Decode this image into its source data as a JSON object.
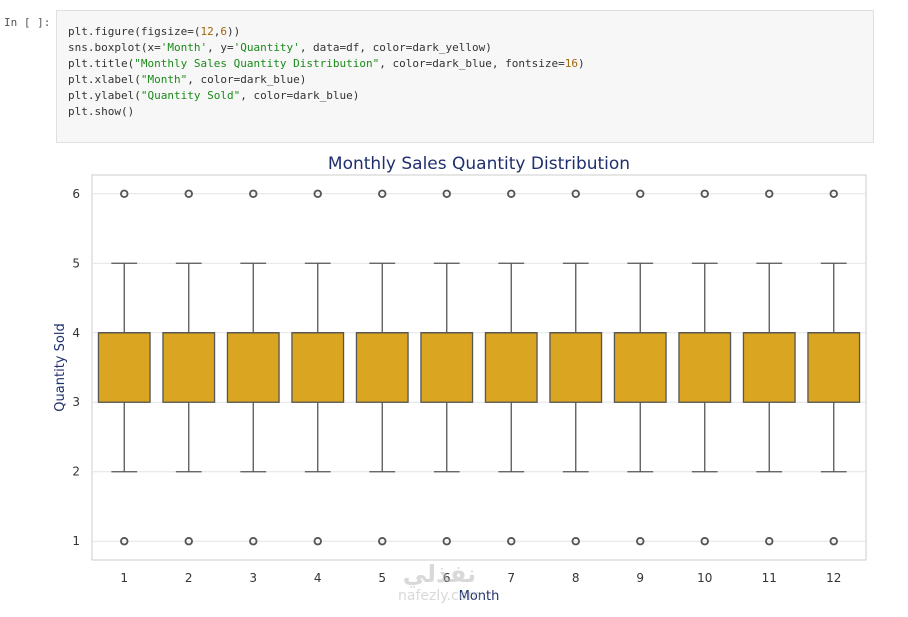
{
  "cell": {
    "prompt": "In [ ]:",
    "code_lines": [
      [
        [
          "plt.figure(figsize=(",
          ""
        ],
        [
          "12",
          "num"
        ],
        [
          ",",
          ""
        ],
        [
          "6",
          "num"
        ],
        [
          "))",
          ""
        ]
      ],
      [
        [
          "sns.boxplot(x=",
          ""
        ],
        [
          "'Month'",
          "str"
        ],
        [
          ", y=",
          ""
        ],
        [
          "'Quantity'",
          "str"
        ],
        [
          ", data=df, color=dark_yellow)",
          ""
        ]
      ],
      [
        [
          "plt.title(",
          ""
        ],
        [
          "\"Monthly Sales Quantity Distribution\"",
          "str"
        ],
        [
          ", color=dark_blue, fontsize=",
          ""
        ],
        [
          "16",
          "num"
        ],
        [
          ")",
          ""
        ]
      ],
      [
        [
          "plt.xlabel(",
          ""
        ],
        [
          "\"Month\"",
          "str"
        ],
        [
          ", color=dark_blue)",
          ""
        ]
      ],
      [
        [
          "plt.ylabel(",
          ""
        ],
        [
          "\"Quantity Sold\"",
          "str"
        ],
        [
          ", color=dark_blue)",
          ""
        ]
      ],
      [
        [
          "plt.show()",
          ""
        ]
      ]
    ]
  },
  "watermark": {
    "arabic": "نفذلي",
    "latin": "nafezly.com"
  },
  "chart_data": {
    "type": "box",
    "title": "Monthly Sales Quantity Distribution",
    "xlabel": "Month",
    "ylabel": "Quantity Sold",
    "categories": [
      "1",
      "2",
      "3",
      "4",
      "5",
      "6",
      "7",
      "8",
      "9",
      "10",
      "11",
      "12"
    ],
    "boxes": {
      "whisker_low": 2,
      "q1": 3,
      "median": 4,
      "q3": 4,
      "whisker_high": 5,
      "outliers": [
        1,
        6
      ]
    },
    "yticks": [
      1,
      2,
      3,
      4,
      5,
      6
    ],
    "ylim": [
      0.73,
      6.27
    ],
    "grid": true,
    "colors": {
      "box": "#DAA520",
      "title": "#1f2f6e",
      "edge": "#555555"
    }
  }
}
